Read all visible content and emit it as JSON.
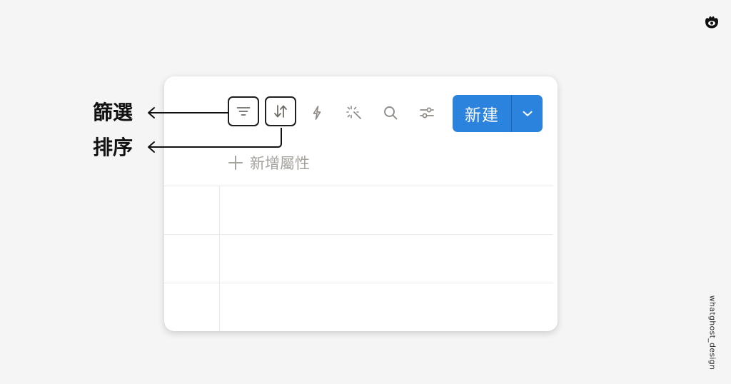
{
  "annotations": {
    "filter_label": "篩選",
    "sort_label": "排序"
  },
  "toolbar": {
    "new_button_label": "新建",
    "add_property_label": "新增屬性"
  },
  "branding": {
    "watermark": "whatghost_design"
  },
  "colors": {
    "primary_button": "#2b83dd",
    "icon": "#8e8b86",
    "muted_text": "#a6a39e",
    "grid_line": "#e9e9e8",
    "background": "#f5f5f5"
  },
  "icons": [
    "filter-icon",
    "sort-icon",
    "lightning-icon",
    "magic-wand-icon",
    "search-icon",
    "sliders-icon",
    "chevron-down-icon",
    "plus-icon"
  ]
}
